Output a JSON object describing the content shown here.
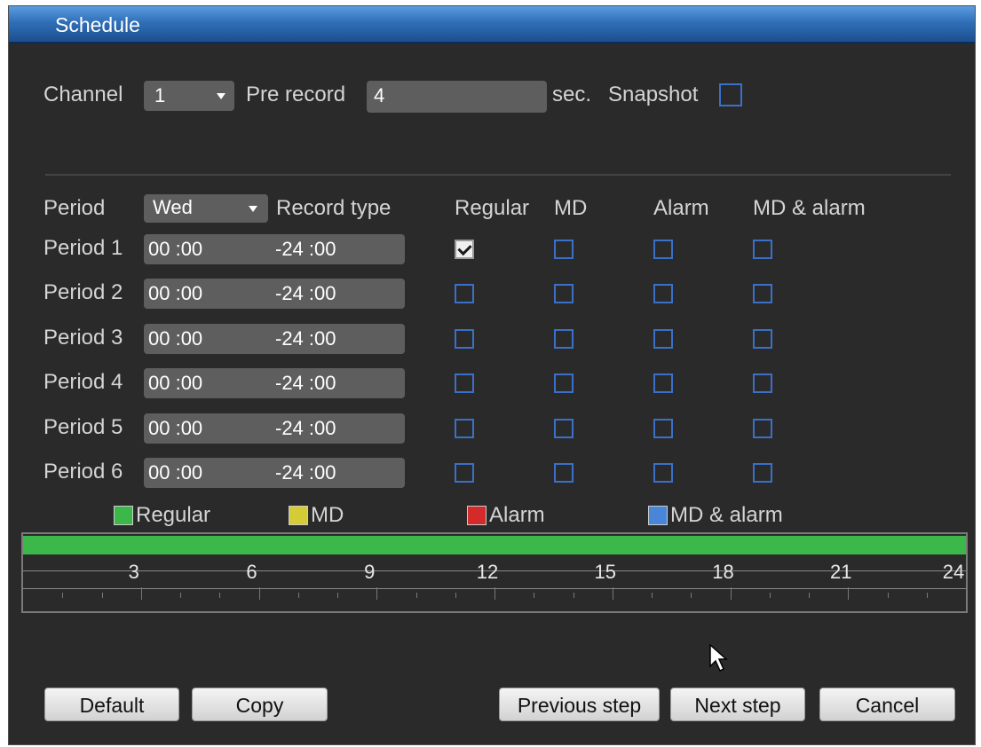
{
  "window": {
    "title": "Schedule"
  },
  "top": {
    "channel_label": "Channel",
    "channel_value": "1",
    "pre_record_label": "Pre record",
    "pre_record_value": "4",
    "sec_label": "sec.",
    "snapshot_label": "Snapshot",
    "snapshot_checked": false
  },
  "schedule": {
    "period_label": "Period",
    "day_value": "Wed",
    "record_type_label": "Record type",
    "columns": [
      "Regular",
      "MD",
      "Alarm",
      "MD & alarm"
    ],
    "rows": [
      {
        "label": "Period 1",
        "start": "00 :00",
        "end": "-24 :00",
        "checks": [
          true,
          false,
          false,
          false
        ]
      },
      {
        "label": "Period 2",
        "start": "00 :00",
        "end": "-24 :00",
        "checks": [
          false,
          false,
          false,
          false
        ]
      },
      {
        "label": "Period 3",
        "start": "00 :00",
        "end": "-24 :00",
        "checks": [
          false,
          false,
          false,
          false
        ]
      },
      {
        "label": "Period 4",
        "start": "00 :00",
        "end": "-24 :00",
        "checks": [
          false,
          false,
          false,
          false
        ]
      },
      {
        "label": "Period 5",
        "start": "00 :00",
        "end": "-24 :00",
        "checks": [
          false,
          false,
          false,
          false
        ]
      },
      {
        "label": "Period 6",
        "start": "00 :00",
        "end": "-24 :00",
        "checks": [
          false,
          false,
          false,
          false
        ]
      }
    ]
  },
  "legend": [
    {
      "label": "Regular",
      "color": "#3cb84a"
    },
    {
      "label": "MD",
      "color": "#d4cc36"
    },
    {
      "label": "Alarm",
      "color": "#d42a2a"
    },
    {
      "label": "MD & alarm",
      "color": "#4a86d8"
    }
  ],
  "timeline": {
    "hours": [
      "3",
      "6",
      "9",
      "12",
      "15",
      "18",
      "21",
      "24"
    ],
    "bar_color": "#3cb84a",
    "coverage_hours": [
      0,
      24
    ]
  },
  "buttons": {
    "default": "Default",
    "copy": "Copy",
    "previous": "Previous step",
    "next": "Next step",
    "cancel": "Cancel"
  }
}
